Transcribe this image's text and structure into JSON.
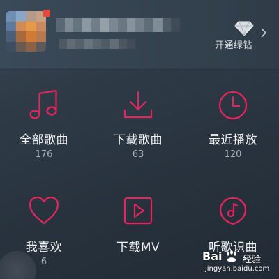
{
  "header": {
    "vip_link": "开通绿钻",
    "diamond_icon": "diamond-icon",
    "chevron_icon": "chevron-right-icon"
  },
  "accent_color": "#e8245d",
  "items": [
    {
      "label": "全部歌曲",
      "count": "176",
      "icon": "music-note-icon"
    },
    {
      "label": "下载歌曲",
      "count": "63",
      "icon": "download-icon"
    },
    {
      "label": "最近播放",
      "count": "120",
      "icon": "clock-icon"
    },
    {
      "label": "我喜欢",
      "count": "6",
      "icon": "heart-icon"
    },
    {
      "label": "下载MV",
      "count": "",
      "icon": "video-play-icon"
    },
    {
      "label": "听歌识曲",
      "count": "",
      "icon": "music-recognize-icon"
    }
  ],
  "watermark": {
    "logo": "Bai",
    "text": "经验",
    "url": "jingyan.baidu.com"
  }
}
